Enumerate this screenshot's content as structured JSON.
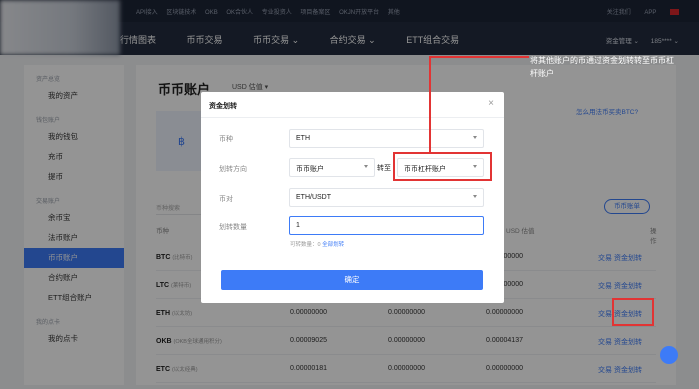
{
  "topbar": {
    "links": [
      "API接入",
      "区块链技术",
      "OKB",
      "OK合伙人",
      "专业投资人",
      "项目备案区",
      "OKJN开放平台",
      "其他"
    ],
    "right": [
      "关注我们",
      "APP"
    ]
  },
  "nav": {
    "items": [
      "行情图表",
      "币币交易",
      "币币交易 ⌄",
      "合约交易 ⌄",
      "ETT组合交易"
    ],
    "right": [
      "资金管理 ⌄",
      "185**** ⌄"
    ]
  },
  "sidebar": {
    "groups": [
      {
        "title": "资产总览",
        "items": [
          "我的资产"
        ]
      },
      {
        "title": "钱包账户",
        "items": [
          "我的钱包",
          "充币",
          "提币"
        ]
      },
      {
        "title": "交易账户",
        "items": [
          "余币宝",
          "法币账户",
          "币币账户",
          "合约账户",
          "ETT组合账户"
        ]
      },
      {
        "title": "我的点卡",
        "items": [
          "我的点卡"
        ]
      }
    ]
  },
  "main": {
    "title": "币币账户",
    "currency": "USD 估值 ▾",
    "howto": "怎么用法币买卖BTC?",
    "tip": "将其他账户的币通过资金划转转至币币杠杆账户",
    "card_icon": "฿",
    "search_placeholder": "币种搜索",
    "bill_button": "币币账单",
    "headers": [
      "币种",
      "",
      "",
      "USD 估值",
      "操作"
    ],
    "rows": [
      {
        "coin": "BTC",
        "sub": "(比特币)",
        "v1": "",
        "v2": "",
        "v3": "0.00000000",
        "trade": "交易",
        "transfer": "资金划转"
      },
      {
        "coin": "LTC",
        "sub": "(莱特币)",
        "v1": "",
        "v2": "",
        "v3": "0.00000000",
        "trade": "交易",
        "transfer": "资金划转"
      },
      {
        "coin": "ETH",
        "sub": "(以太坊)",
        "v1": "0.00000000",
        "v2": "0.00000000",
        "v3": "0.00000000",
        "trade": "交易",
        "transfer": "资金划转"
      },
      {
        "coin": "OKB",
        "sub": "(OKB全球通用积分)",
        "v1": "0.00009025",
        "v2": "0.00000000",
        "v3": "0.00004137",
        "trade": "交易",
        "transfer": "资金划转"
      },
      {
        "coin": "ETC",
        "sub": "(以太经典)",
        "v1": "0.00000181",
        "v2": "0.00000000",
        "v3": "0.00000000",
        "trade": "交易",
        "transfer": "资金划转"
      }
    ]
  },
  "modal": {
    "title": "资金划转",
    "close": "×",
    "coin_label": "币种",
    "coin_value": "ETH",
    "direction_label": "划转方向",
    "from_value": "币币账户",
    "to_label": "转至",
    "to_value": "币币杠杆账户",
    "pair_label": "币对",
    "pair_value": "ETH/USDT",
    "amount_label": "划转数量",
    "amount_value": "1",
    "available_text": "可转数量：0",
    "transfer_all": "全部划转",
    "confirm": "确定"
  },
  "colors": {
    "accent": "#3d7bf7",
    "highlight": "#e23434"
  }
}
